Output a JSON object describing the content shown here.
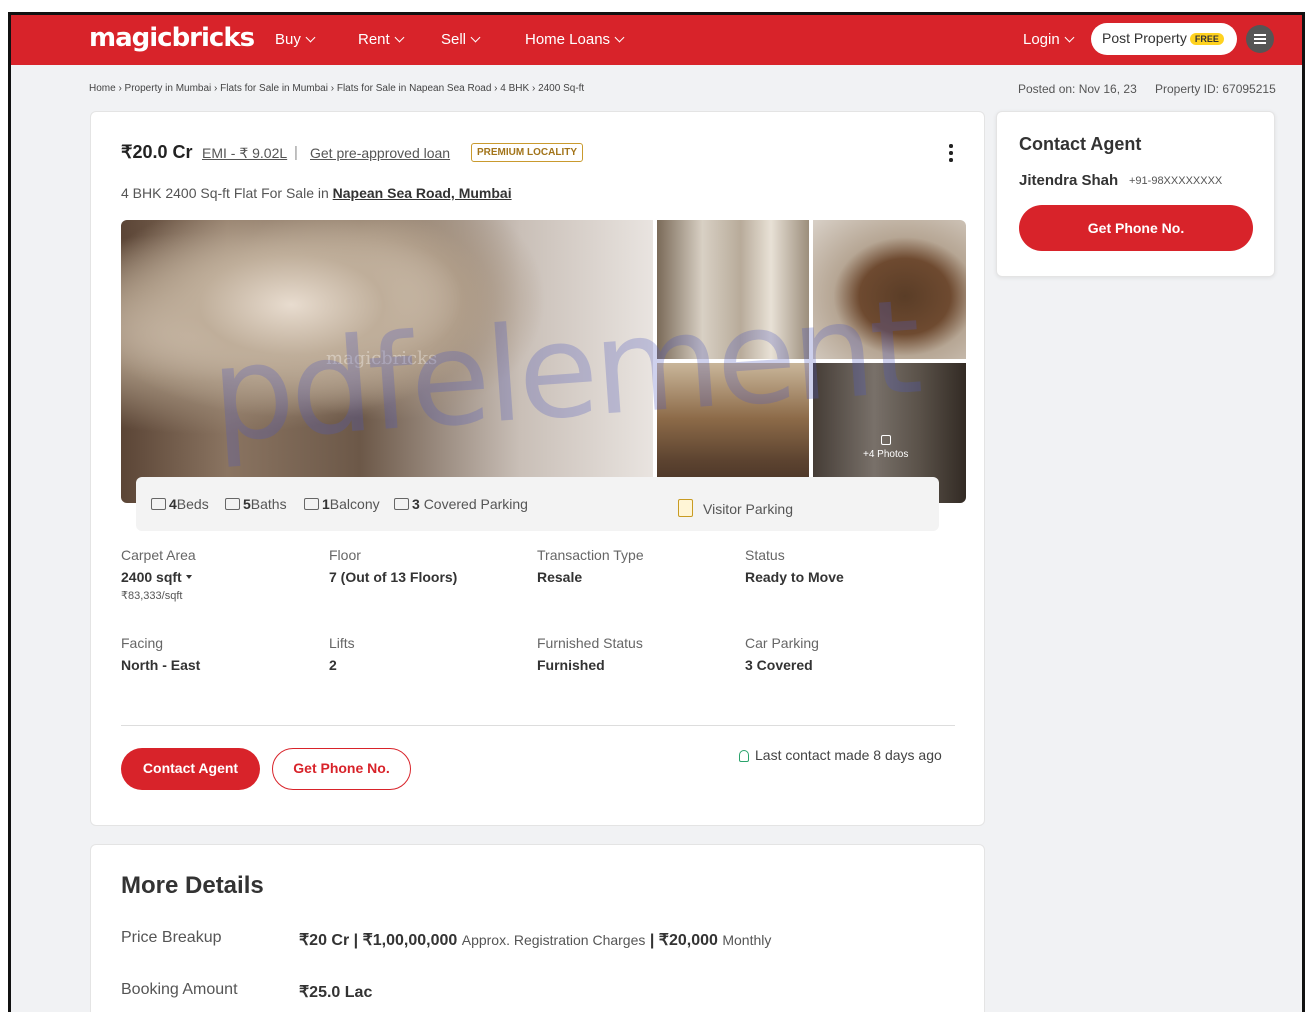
{
  "header": {
    "logo": "magicbricks",
    "nav": [
      "Buy",
      "Rent",
      "Sell",
      "Home Loans"
    ],
    "login": "Login",
    "post_property": "Post Property",
    "free_badge": "FREE"
  },
  "breadcrumb": "Home › Property in Mumbai › Flats for Sale in Mumbai › Flats for Sale in Napean Sea Road › 4 BHK › 2400 Sq-ft",
  "posted_on": "Posted on: Nov 16, 23",
  "property_id": "Property ID: 67095215",
  "listing": {
    "price": "₹20.0 Cr",
    "emi": "EMI - ₹ 9.02L",
    "separator": "|",
    "loan_link": "Get pre-approved loan",
    "premium": "PREMIUM LOCALITY",
    "subtitle_prefix": "4 BHK 2400 Sq-ft Flat For Sale in",
    "location": "Napean Sea Road, Mumbai",
    "gallery_watermark": "magicbricks",
    "more_photos": "+4 Photos",
    "amenities": {
      "beds_num": "4",
      "beds_label": "Beds",
      "baths_num": "5",
      "baths_label": "Baths",
      "balcony_num": "1",
      "balcony_label": "Balcony",
      "parking_num": "3",
      "parking_label": "Covered Parking",
      "visitor": "Visitor Parking"
    },
    "specs": {
      "carpet_label": "Carpet Area",
      "carpet_value": "2400 sqft",
      "carpet_rate": "₹83,333/sqft",
      "floor_label": "Floor",
      "floor_value": "7 (Out of 13 Floors)",
      "transaction_label": "Transaction Type",
      "transaction_value": "Resale",
      "status_label": "Status",
      "status_value": "Ready to Move",
      "facing_label": "Facing",
      "facing_value": "North - East",
      "lifts_label": "Lifts",
      "lifts_value": "2",
      "furnished_label": "Furnished Status",
      "furnished_value": "Furnished",
      "car_label": "Car Parking",
      "car_value": "3 Covered"
    },
    "contact_btn": "Contact Agent",
    "phone_btn": "Get Phone No.",
    "last_contact": "Last contact made 8 days ago"
  },
  "agent_card": {
    "title": "Contact Agent",
    "name": "Jitendra Shah",
    "phone": "+91-98XXXXXXXX",
    "button": "Get Phone No."
  },
  "more_details": {
    "title": "More Details",
    "price_label": "Price Breakup",
    "price_main": "₹20 Cr | ₹1,00,00,000",
    "price_reg": "Approx. Registration Charges",
    "price_sep": "|",
    "price_monthly": "₹20,000",
    "price_monthly_label": "Monthly",
    "booking_label": "Booking Amount",
    "booking_value": "₹25.0 Lac"
  },
  "overlay_watermark": "pdfelement",
  "colors": {
    "brand_red": "#d8232a",
    "premium_gold": "#c99a2e",
    "free_yellow": "#ffd21f"
  }
}
